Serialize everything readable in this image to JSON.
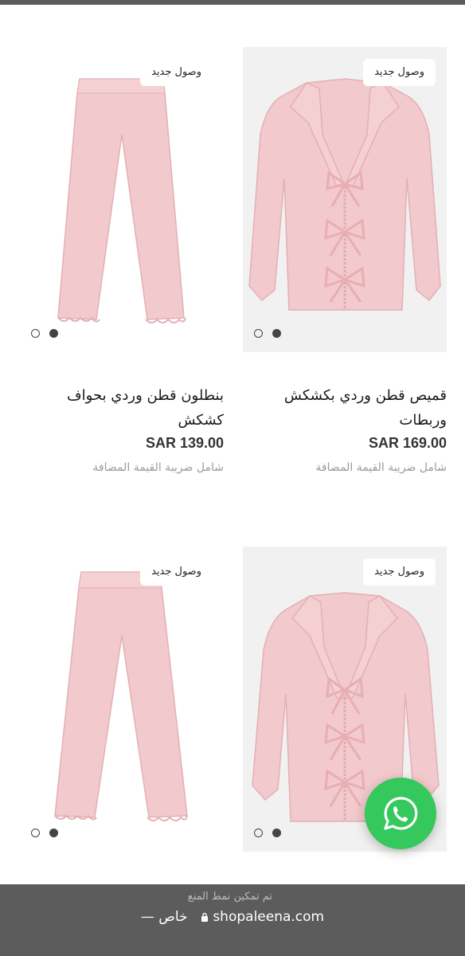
{
  "products": [
    {
      "badge": "وصول جديد",
      "name": "قميص قطن وردي بكشكش وربطات",
      "price": "SAR 169.00",
      "tax_note": "شامل ضريبة القيمة المضافة"
    },
    {
      "badge": "وصول جديد",
      "name": "بنطلون قطن وردي بحواف كشكش",
      "price": "SAR 139.00",
      "tax_note": "شامل ضريبة القيمة المضافة"
    },
    {
      "badge": "وصول جديد"
    },
    {
      "badge": "وصول جديد"
    }
  ],
  "browser": {
    "notice": "تم تمكين نمط المنع",
    "url": "shopaleena.com",
    "mode_label": "— خاص"
  },
  "icons": {
    "whatsapp": "whatsapp-icon",
    "lock": "lock-icon",
    "carousel_dot": "carousel-dot"
  },
  "colors": {
    "product_pink": "#f2c9cc",
    "whatsapp_green": "#35c85d",
    "bottom_bar": "#5c5c5c"
  }
}
